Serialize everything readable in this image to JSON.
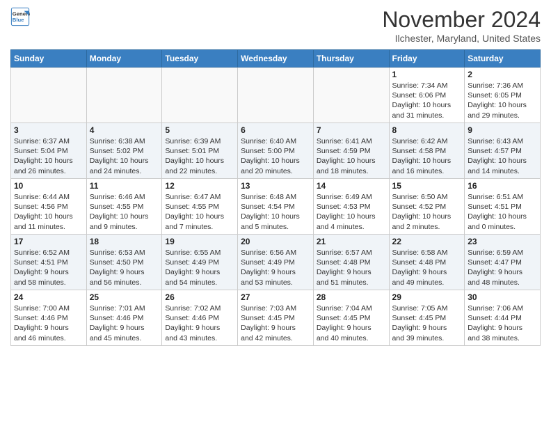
{
  "header": {
    "logo_general": "General",
    "logo_blue": "Blue",
    "month": "November 2024",
    "location": "Ilchester, Maryland, United States"
  },
  "weekdays": [
    "Sunday",
    "Monday",
    "Tuesday",
    "Wednesday",
    "Thursday",
    "Friday",
    "Saturday"
  ],
  "weeks": [
    [
      {
        "day": "",
        "info": ""
      },
      {
        "day": "",
        "info": ""
      },
      {
        "day": "",
        "info": ""
      },
      {
        "day": "",
        "info": ""
      },
      {
        "day": "",
        "info": ""
      },
      {
        "day": "1",
        "info": "Sunrise: 7:34 AM\nSunset: 6:06 PM\nDaylight: 10 hours\nand 31 minutes."
      },
      {
        "day": "2",
        "info": "Sunrise: 7:36 AM\nSunset: 6:05 PM\nDaylight: 10 hours\nand 29 minutes."
      }
    ],
    [
      {
        "day": "3",
        "info": "Sunrise: 6:37 AM\nSunset: 5:04 PM\nDaylight: 10 hours\nand 26 minutes."
      },
      {
        "day": "4",
        "info": "Sunrise: 6:38 AM\nSunset: 5:02 PM\nDaylight: 10 hours\nand 24 minutes."
      },
      {
        "day": "5",
        "info": "Sunrise: 6:39 AM\nSunset: 5:01 PM\nDaylight: 10 hours\nand 22 minutes."
      },
      {
        "day": "6",
        "info": "Sunrise: 6:40 AM\nSunset: 5:00 PM\nDaylight: 10 hours\nand 20 minutes."
      },
      {
        "day": "7",
        "info": "Sunrise: 6:41 AM\nSunset: 4:59 PM\nDaylight: 10 hours\nand 18 minutes."
      },
      {
        "day": "8",
        "info": "Sunrise: 6:42 AM\nSunset: 4:58 PM\nDaylight: 10 hours\nand 16 minutes."
      },
      {
        "day": "9",
        "info": "Sunrise: 6:43 AM\nSunset: 4:57 PM\nDaylight: 10 hours\nand 14 minutes."
      }
    ],
    [
      {
        "day": "10",
        "info": "Sunrise: 6:44 AM\nSunset: 4:56 PM\nDaylight: 10 hours\nand 11 minutes."
      },
      {
        "day": "11",
        "info": "Sunrise: 6:46 AM\nSunset: 4:55 PM\nDaylight: 10 hours\nand 9 minutes."
      },
      {
        "day": "12",
        "info": "Sunrise: 6:47 AM\nSunset: 4:55 PM\nDaylight: 10 hours\nand 7 minutes."
      },
      {
        "day": "13",
        "info": "Sunrise: 6:48 AM\nSunset: 4:54 PM\nDaylight: 10 hours\nand 5 minutes."
      },
      {
        "day": "14",
        "info": "Sunrise: 6:49 AM\nSunset: 4:53 PM\nDaylight: 10 hours\nand 4 minutes."
      },
      {
        "day": "15",
        "info": "Sunrise: 6:50 AM\nSunset: 4:52 PM\nDaylight: 10 hours\nand 2 minutes."
      },
      {
        "day": "16",
        "info": "Sunrise: 6:51 AM\nSunset: 4:51 PM\nDaylight: 10 hours\nand 0 minutes."
      }
    ],
    [
      {
        "day": "17",
        "info": "Sunrise: 6:52 AM\nSunset: 4:51 PM\nDaylight: 9 hours\nand 58 minutes."
      },
      {
        "day": "18",
        "info": "Sunrise: 6:53 AM\nSunset: 4:50 PM\nDaylight: 9 hours\nand 56 minutes."
      },
      {
        "day": "19",
        "info": "Sunrise: 6:55 AM\nSunset: 4:49 PM\nDaylight: 9 hours\nand 54 minutes."
      },
      {
        "day": "20",
        "info": "Sunrise: 6:56 AM\nSunset: 4:49 PM\nDaylight: 9 hours\nand 53 minutes."
      },
      {
        "day": "21",
        "info": "Sunrise: 6:57 AM\nSunset: 4:48 PM\nDaylight: 9 hours\nand 51 minutes."
      },
      {
        "day": "22",
        "info": "Sunrise: 6:58 AM\nSunset: 4:48 PM\nDaylight: 9 hours\nand 49 minutes."
      },
      {
        "day": "23",
        "info": "Sunrise: 6:59 AM\nSunset: 4:47 PM\nDaylight: 9 hours\nand 48 minutes."
      }
    ],
    [
      {
        "day": "24",
        "info": "Sunrise: 7:00 AM\nSunset: 4:46 PM\nDaylight: 9 hours\nand 46 minutes."
      },
      {
        "day": "25",
        "info": "Sunrise: 7:01 AM\nSunset: 4:46 PM\nDaylight: 9 hours\nand 45 minutes."
      },
      {
        "day": "26",
        "info": "Sunrise: 7:02 AM\nSunset: 4:46 PM\nDaylight: 9 hours\nand 43 minutes."
      },
      {
        "day": "27",
        "info": "Sunrise: 7:03 AM\nSunset: 4:45 PM\nDaylight: 9 hours\nand 42 minutes."
      },
      {
        "day": "28",
        "info": "Sunrise: 7:04 AM\nSunset: 4:45 PM\nDaylight: 9 hours\nand 40 minutes."
      },
      {
        "day": "29",
        "info": "Sunrise: 7:05 AM\nSunset: 4:45 PM\nDaylight: 9 hours\nand 39 minutes."
      },
      {
        "day": "30",
        "info": "Sunrise: 7:06 AM\nSunset: 4:44 PM\nDaylight: 9 hours\nand 38 minutes."
      }
    ]
  ]
}
